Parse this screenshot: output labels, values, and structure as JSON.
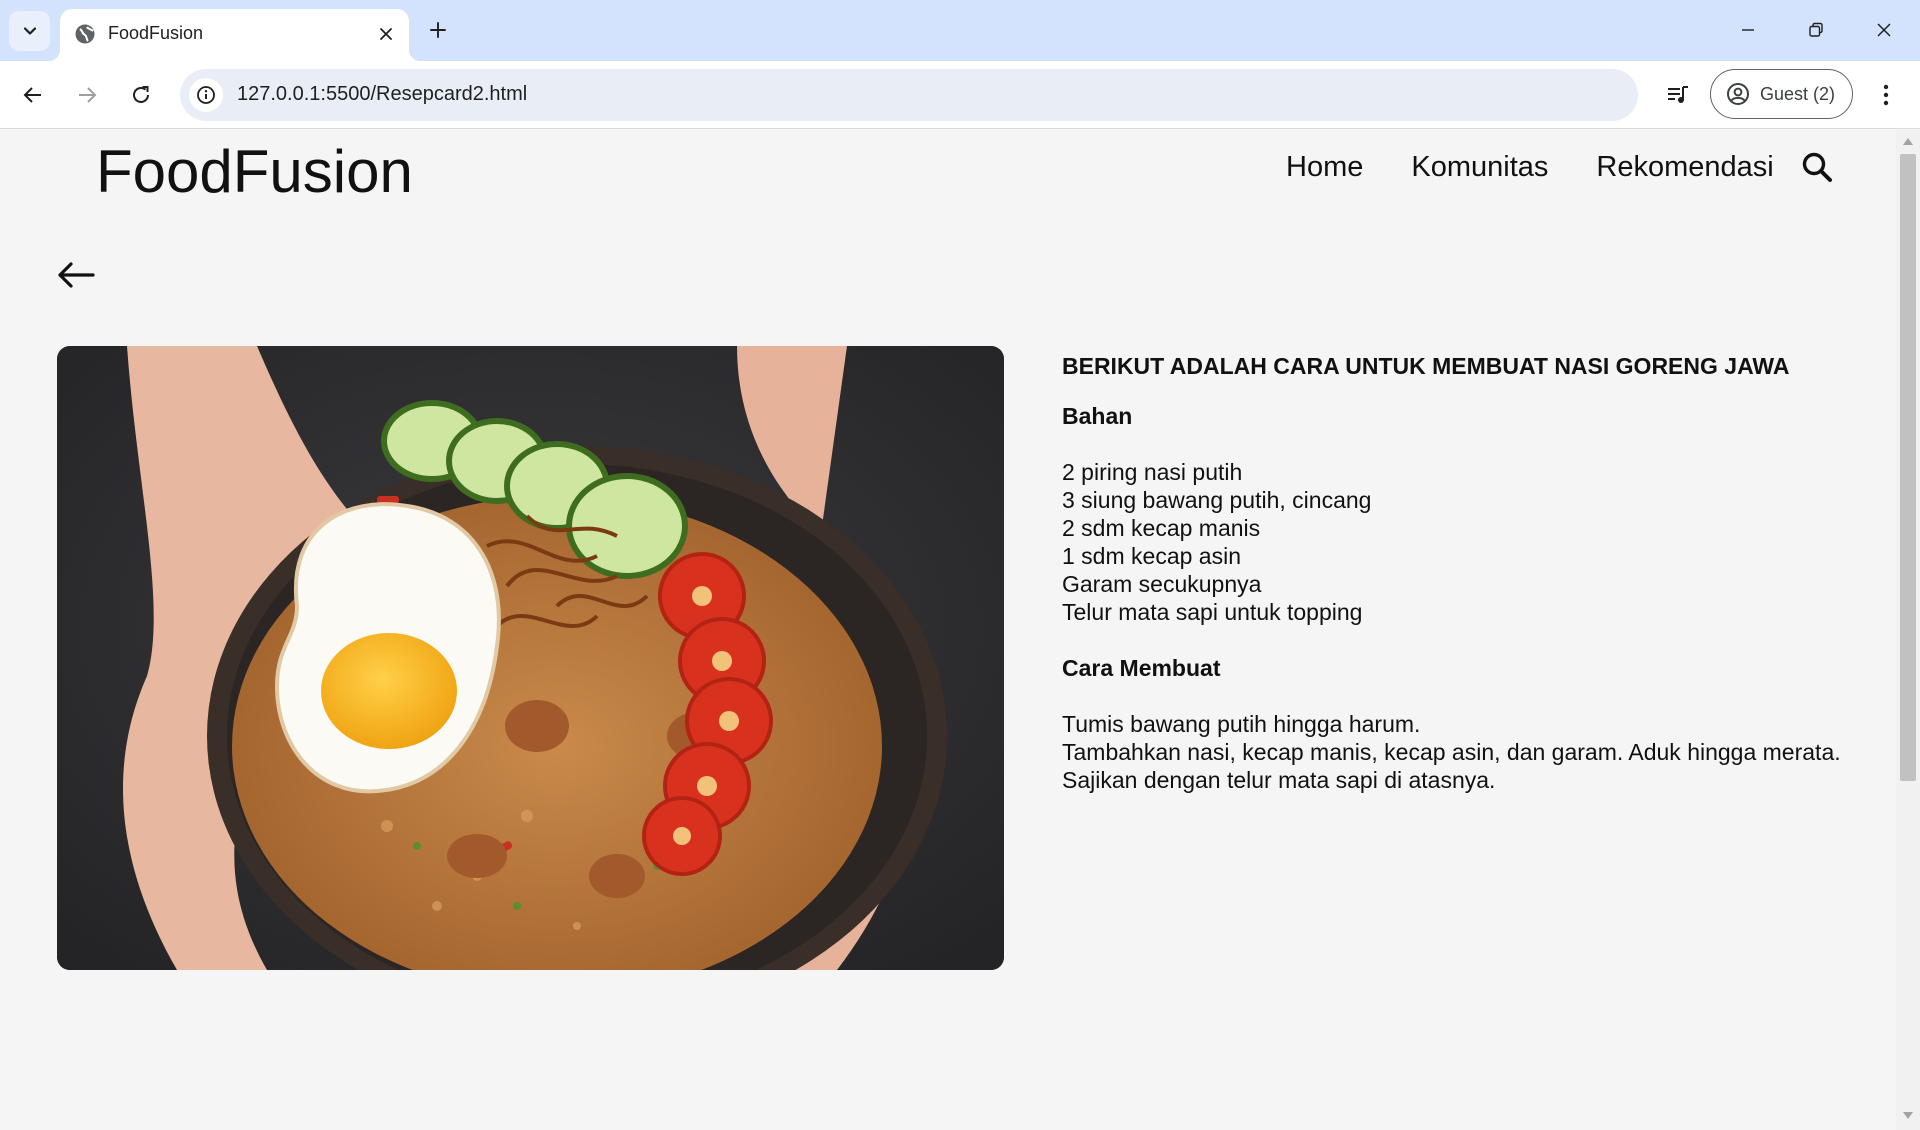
{
  "browser": {
    "tab_title": "FoodFusion",
    "url": "127.0.0.1:5500/Resepcard2.html",
    "profile_label": "Guest (2)"
  },
  "site": {
    "brand": "FoodFusion",
    "nav": [
      "Home",
      "Komunitas",
      "Rekomendasi"
    ]
  },
  "recipe": {
    "title": "BERIKUT ADALAH CARA UNTUK MEMBUAT NASI GORENG JAWA",
    "ingredients_heading": "Bahan",
    "ingredients": [
      "2 piring nasi putih",
      "3 siung bawang putih, cincang",
      "2 sdm kecap manis",
      "1 sdm kecap asin",
      "Garam secukupnya",
      "Telur mata sapi untuk topping"
    ],
    "steps_heading": "Cara Membuat",
    "steps": [
      "Tumis bawang putih hingga harum.",
      "Tambahkan nasi, kecap manis, kecap asin, dan garam. Aduk hingga merata.",
      "Sajikan dengan telur mata sapi di atasnya."
    ]
  },
  "colors": {
    "tabstrip": "#d3e3fd",
    "page_background": "#f5f5f5",
    "text": "#111111"
  },
  "icons": {
    "tab_list": "chevron-down-icon",
    "favicon": "globe-icon",
    "back_link": "arrow-left-icon",
    "search": "search-icon"
  }
}
